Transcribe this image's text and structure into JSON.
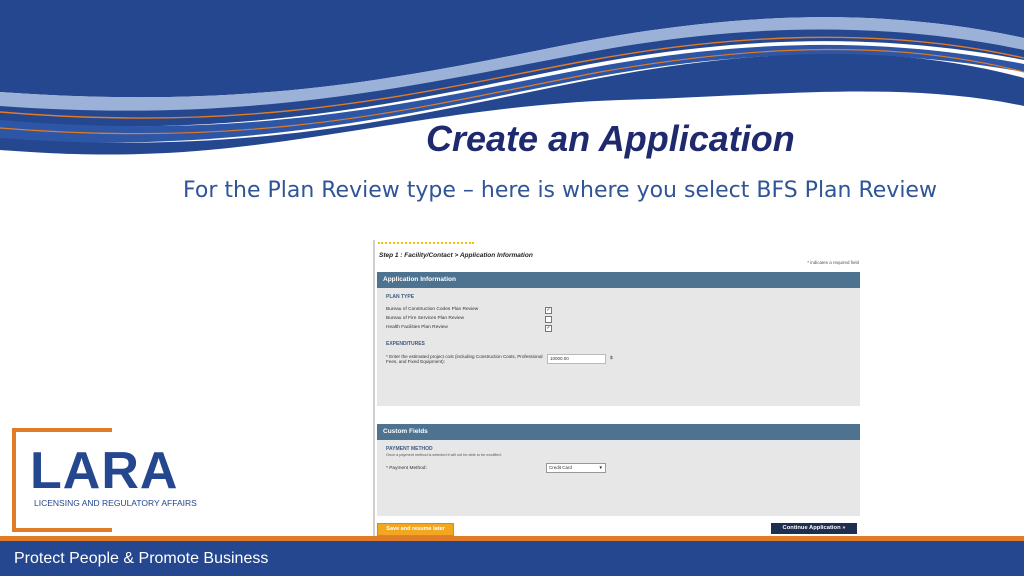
{
  "slide": {
    "title": "Create an Application",
    "subtitle": "For the Plan Review type – here is where you select BFS Plan Review"
  },
  "screenshot": {
    "breadcrumb": "Step 1 : Facility/Contact > Application Information",
    "required_note": "* indicates a required field",
    "application_panel": {
      "header": "Application Information",
      "plan_type": {
        "label": "PLAN TYPE",
        "options": [
          {
            "label": "Bureau of Construction Codes Plan Review",
            "checked": true
          },
          {
            "label": "Bureau of Fire Services Plan Review",
            "checked": false
          },
          {
            "label": "Health Facilities Plan Review",
            "checked": true
          }
        ]
      },
      "expenditures": {
        "label": "EXPENDITURES",
        "field_label": "* Enter the estimated project cost (including Construction Costs, Professional Fees, and Fixed Equipment):",
        "value": "10000.00",
        "suffix": "$"
      }
    },
    "custom_panel": {
      "header": "Custom Fields",
      "payment": {
        "label": "PAYMENT METHOD",
        "note": "Once a payment method is selected it will not be able to be modified.",
        "field_label": "* Payment Method:",
        "selected": "Credit Card"
      }
    },
    "buttons": {
      "save_label": "Save and resume later",
      "continue_label": "Continue Application »"
    }
  },
  "logo": {
    "name": "LARA",
    "tagline": "LICENSING AND REGULATORY AFFAIRS"
  },
  "footer": {
    "text": "Protect People & Promote Business"
  },
  "colors": {
    "navy": "#1f2a6e",
    "blue": "#24478f",
    "orange": "#e07b27",
    "panel_header": "#4d7391"
  }
}
